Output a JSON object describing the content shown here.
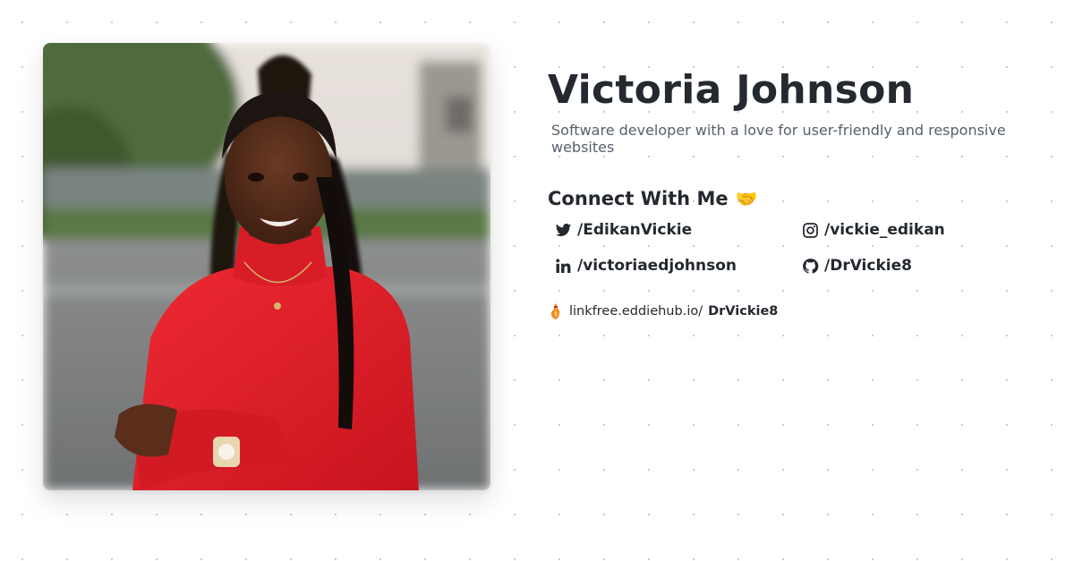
{
  "profile": {
    "name": "Victoria Johnson",
    "bio": "Software developer with a love for user-friendly and responsive websites"
  },
  "connect": {
    "heading": "Connect With Me",
    "heading_emoji": "🤝",
    "links": [
      {
        "icon": "twitter-icon",
        "handle": "/EdikanVickie"
      },
      {
        "icon": "instagram-icon",
        "handle": "/vickie_edikan"
      },
      {
        "icon": "linkedin-icon",
        "handle": "/victoriaedjohnson"
      },
      {
        "icon": "github-icon",
        "handle": "/DrVickie8"
      }
    ]
  },
  "linkfree": {
    "icon": "linkfree-logo-icon",
    "domain": "linkfree.eddiehub.io/",
    "username": "DrVickie8"
  },
  "colors": {
    "text": "#24292f",
    "muted": "#57606a",
    "dots": "#c9c9c9",
    "sweater": "#e0202a"
  }
}
